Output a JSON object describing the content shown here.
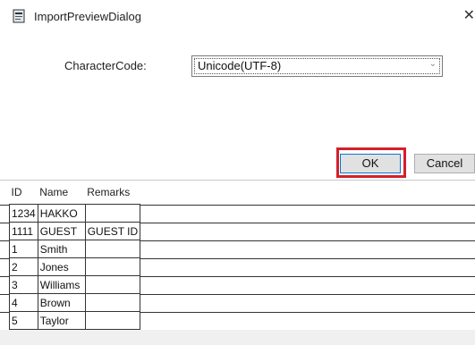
{
  "window": {
    "title": "ImportPreviewDialog",
    "close_glyph": "✕",
    "app_icon": "document-icon"
  },
  "form": {
    "character_code_label": "CharacterCode:",
    "character_code_value": "Unicode(UTF-8)"
  },
  "buttons": {
    "ok": "OK",
    "cancel": "Cancel"
  },
  "grid": {
    "columns": [
      "ID",
      "Name",
      "Remarks"
    ],
    "rows": [
      [
        "1234",
        "HAKKO",
        ""
      ],
      [
        "1111",
        "GUEST",
        "GUEST ID"
      ],
      [
        "1",
        "Smith",
        ""
      ],
      [
        "2",
        "Jones",
        ""
      ],
      [
        "3",
        "Williams",
        ""
      ],
      [
        "4",
        "Brown",
        ""
      ],
      [
        "5",
        "Taylor",
        ""
      ]
    ]
  },
  "colors": {
    "highlight": "#d3202a",
    "focus_border": "#0078d7"
  }
}
